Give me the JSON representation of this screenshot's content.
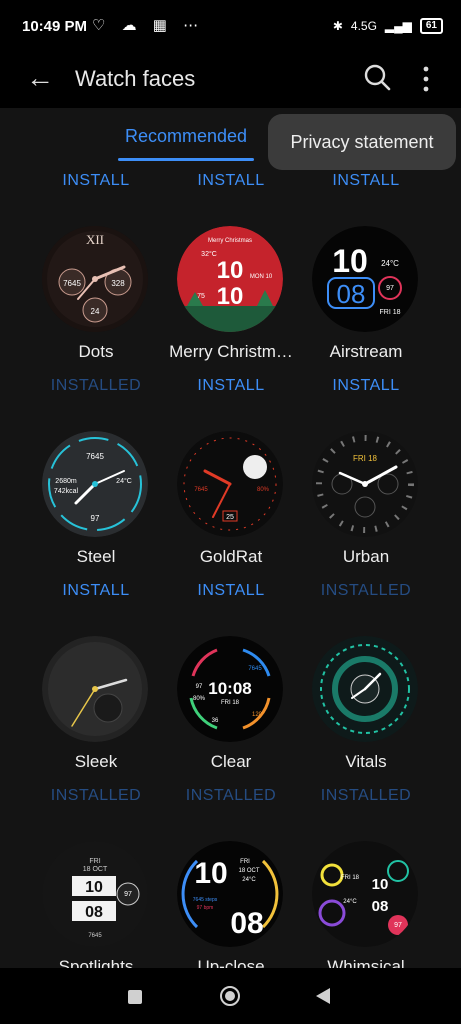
{
  "status_bar": {
    "time": "10:49 PM",
    "icons": "♡ ☁ ▦ ⋯",
    "network": "4.5G",
    "battery": "61"
  },
  "app_bar": {
    "title": "Watch faces"
  },
  "tabs": [
    {
      "label": "Recommended"
    }
  ],
  "popup": {
    "privacy_label": "Privacy statement"
  },
  "top_buttons": [
    "INSTALL",
    "INSTALL",
    "INSTALL"
  ],
  "faces": [
    {
      "name": "Dots",
      "button": "INSTALLED",
      "bg": "#1a1210",
      "accent": "#c99b8e"
    },
    {
      "name": "Merry Christm…",
      "button": "INSTALL",
      "bg": "#c5232c",
      "accent": "#ffffff"
    },
    {
      "name": "Airstream",
      "button": "INSTALL",
      "bg": "#050505",
      "accent": "#3d8ef7"
    },
    {
      "name": "Steel",
      "button": "INSTALL",
      "bg": "#2a2d30",
      "accent": "#27c2d8"
    },
    {
      "name": "GoldRat",
      "button": "INSTALL",
      "bg": "#0c0c0c",
      "accent": "#e03a26"
    },
    {
      "name": "Urban",
      "button": "INSTALLED",
      "bg": "#111111",
      "accent": "#ffffff"
    },
    {
      "name": "Sleek",
      "button": "INSTALLED",
      "bg": "#232323",
      "accent": "#e7c64a"
    },
    {
      "name": "Clear",
      "button": "INSTALLED",
      "bg": "#050505",
      "accent": "#2e8bf0"
    },
    {
      "name": "Vitals",
      "button": "INSTALLED",
      "bg": "#0e1a1a",
      "accent": "#21c2a4"
    },
    {
      "name": "Spotlights",
      "button": "",
      "bg": "#151515",
      "accent": "#ffffff"
    },
    {
      "name": "Up-close",
      "button": "",
      "bg": "#050505",
      "accent": "#f2c23b"
    },
    {
      "name": "Whimsical",
      "button": "",
      "bg": "#0e0e0e",
      "accent": "#e0345a"
    }
  ],
  "face_text": {
    "dots": {
      "numeral": "XII",
      "steps": "7645",
      "hr": "328",
      "day": "24"
    },
    "christmas": {
      "banner": "Merry Christmas",
      "temp": "32°C",
      "hour": "10",
      "minute": "10",
      "date": "MON 10",
      "steps": "75"
    },
    "airstream": {
      "hour": "10",
      "minute": "08",
      "temp": "24°C",
      "hr": "97",
      "date": "FRI 18"
    },
    "steel": {
      "steps": "7645",
      "dist": "2680m",
      "kcal": "742kcal",
      "temp": "24°C",
      "hr": "97"
    },
    "goldrat": {
      "steps": "7645",
      "pct": "80%",
      "date": "25"
    },
    "urban": {
      "date": "FRI 18"
    },
    "clear": {
      "time": "10:08",
      "date": "FRI 18",
      "hr": "97",
      "steps": "7645",
      "pct": "80%",
      "num": "36",
      "num2": "120"
    },
    "spotlights": {
      "date": "FRI",
      "date2": "18 OCT",
      "hour": "10",
      "minute": "08",
      "hr": "97",
      "steps": "7645"
    },
    "upclose": {
      "hour": "10",
      "minute": "08",
      "date": "FRI",
      "date2": "18 OCT",
      "temp": "24°C",
      "steps": "7645 steps",
      "hr": "97 bpm"
    },
    "whimsical": {
      "date": "FRI 18",
      "hour": "10",
      "minute": "08",
      "temp": "24°C",
      "hr": "97"
    }
  }
}
